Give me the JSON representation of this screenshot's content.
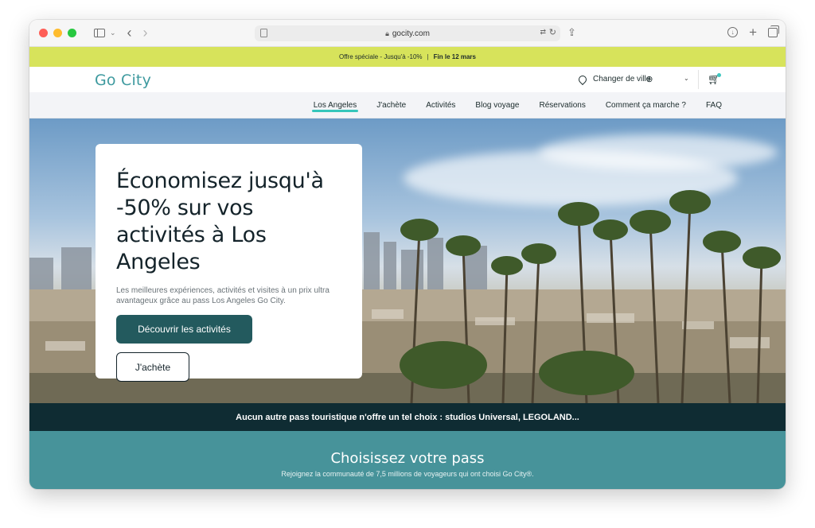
{
  "browser": {
    "url": "gocity.com"
  },
  "promo": {
    "offer": "Offre spéciale - Jusqu'à -10%",
    "separator": "|",
    "deadline": "Fin le 12 mars"
  },
  "header": {
    "logo": "Go City",
    "city_select_label": "Changer de ville"
  },
  "nav": {
    "items": [
      {
        "label": "Los Angeles",
        "active": true
      },
      {
        "label": "J'achète"
      },
      {
        "label": "Activités"
      },
      {
        "label": "Blog voyage"
      },
      {
        "label": "Réservations"
      },
      {
        "label": "Comment ça marche ?"
      },
      {
        "label": "FAQ"
      }
    ]
  },
  "hero": {
    "title": "Économisez jusqu'à -50% sur vos activités à Los Angeles",
    "subtitle": "Les meilleures expériences, activités et visites à un prix ultra avantageux grâce au pass Los Angeles Go City.",
    "primary_button": "Découvrir les activités",
    "secondary_button": "J'achète"
  },
  "banner": {
    "text": "Aucun autre pass touristique n'offre un tel choix : studios Universal, LEGOLAND..."
  },
  "pass_section": {
    "title": "Choisissez votre pass",
    "subtitle": "Rejoignez la communauté de 7,5 millions de voyageurs qui ont choisi Go City®."
  },
  "colors": {
    "promo_bg": "#d7e35b",
    "brand_teal": "#3e9a9f",
    "primary_button": "#235a5e",
    "banner_bg": "#0f2c33",
    "section_teal": "#47939a",
    "active_underline": "#35c6bb"
  }
}
